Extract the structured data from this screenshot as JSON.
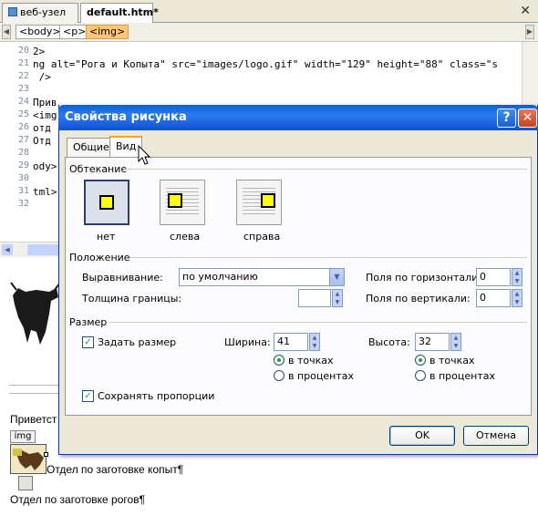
{
  "tabs": [
    {
      "label": "веб-узел"
    },
    {
      "label": "default.htm*"
    }
  ],
  "tagbar": {
    "tags": [
      "<body>",
      "<p>",
      "<img>"
    ]
  },
  "code": {
    "lines": [
      {
        "num": "20",
        "text": "2>"
      },
      {
        "num": "21",
        "text": "ng alt=\"Рога и Копыта\" src=\"images/logo.gif\" width=\"129\" height=\"88\" class=\"s"
      },
      {
        "num": "22",
        "text": " />"
      },
      {
        "num": "23",
        "text": ""
      },
      {
        "num": "24",
        "text": "Прив"
      },
      {
        "num": "25",
        "text": "<img"
      },
      {
        "num": "26",
        "text": "отд"
      },
      {
        "num": "27",
        "text": "Отд"
      },
      {
        "num": "28",
        "text": ""
      },
      {
        "num": "29",
        "text": "ody>"
      },
      {
        "num": "30",
        "text": ""
      },
      {
        "num": "31",
        "text": "tml>"
      },
      {
        "num": "32",
        "text": ""
      }
    ]
  },
  "design": {
    "greeting": "Приветст",
    "img_tag": "img",
    "para1": "Отдел по заготовке копыт¶",
    "para2": "Отдел по заготовке рогов¶"
  },
  "dialog": {
    "title": "Свойства рисунка",
    "tabs": [
      "Общие",
      "Вид"
    ],
    "wrap_section": "Обтекание",
    "wrap_options": [
      "нет",
      "слева",
      "справа"
    ],
    "position_section": "Положение",
    "align_label": "Выравнивание:",
    "align_value": "по умолчанию",
    "border_label": "Толщина границы:",
    "border_value": "",
    "hspace_label": "Поля по горизонтали:",
    "hspace_value": "0",
    "vspace_label": "Поля по вертикали:",
    "vspace_value": "0",
    "size_section": "Размер",
    "set_size_label": "Задать размер",
    "width_label": "Ширина:",
    "width_value": "41",
    "height_label": "Высота:",
    "height_value": "32",
    "unit_px": "в точках",
    "unit_pct": "в процентах",
    "keep_ratio_label": "Сохранять пропорции",
    "ok": "OK",
    "cancel": "Отмена"
  }
}
